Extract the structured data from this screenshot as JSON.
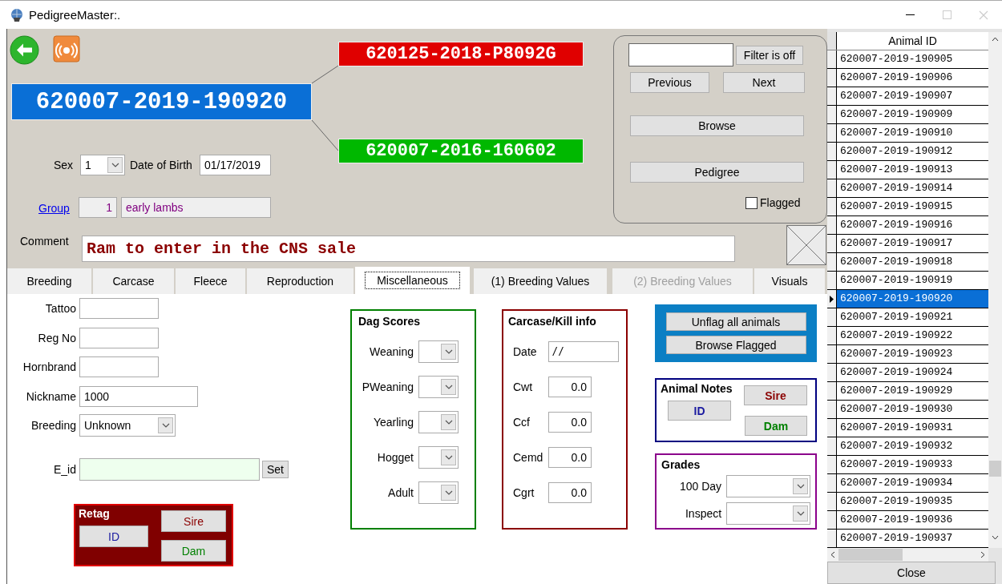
{
  "window": {
    "title": "PedigreeMaster:."
  },
  "pedigree": {
    "animal_id": "620007-2019-190920",
    "sire_id": "620125-2018-P8092G",
    "dam_id": "620007-2016-160602"
  },
  "sex": {
    "label": "Sex",
    "value": "1"
  },
  "date_of_birth": {
    "label": "Date of Birth",
    "value": "01/17/2019"
  },
  "group": {
    "label": "Group",
    "number": "1",
    "name": "early lambs"
  },
  "comment": {
    "label": "Comment",
    "value": "Ram to enter in the CNS sale"
  },
  "navigator": {
    "filter_button": "Filter is off",
    "previous": "Previous",
    "next": "Next",
    "browse": "Browse",
    "pedigree": "Pedigree",
    "flagged": {
      "label": "Flagged",
      "checked": false
    }
  },
  "tabs": [
    {
      "label": "Breeding",
      "selected": false,
      "disabled": false
    },
    {
      "label": "Carcase",
      "selected": false,
      "disabled": false
    },
    {
      "label": "Fleece",
      "selected": false,
      "disabled": false
    },
    {
      "label": "Reproduction",
      "selected": false,
      "disabled": false
    },
    {
      "label": "Miscellaneous",
      "selected": true,
      "disabled": false
    },
    {
      "label": "(1) Breeding Values",
      "selected": false,
      "disabled": false
    },
    {
      "label": "(2) Breeding Values",
      "selected": false,
      "disabled": true
    },
    {
      "label": "Visuals",
      "selected": false,
      "disabled": false
    }
  ],
  "misc_fields": [
    {
      "kind": "text",
      "label": "Tattoo"
    },
    {
      "kind": "text",
      "label": "Reg No"
    },
    {
      "kind": "text",
      "label": "Hornbrand"
    },
    {
      "kind": "wide",
      "label": "Nickname",
      "value": "1000"
    },
    {
      "kind": "dropdown",
      "label": "Breeding",
      "value": "Unknown"
    }
  ],
  "e_id": {
    "label": "E_id",
    "button": "Set"
  },
  "retag": {
    "title": "Retag",
    "id": "ID",
    "sire": "Sire",
    "dam": "Dam"
  },
  "dag_scores": {
    "title": "Dag Scores",
    "items": [
      "Weaning",
      "PWeaning",
      "Yearling",
      "Hogget",
      "Adult"
    ]
  },
  "carcase_kill": {
    "title": "Carcase/Kill info",
    "items": [
      {
        "kind": "date",
        "label": "Date",
        "value": "/ /"
      },
      {
        "kind": "number",
        "label": "Cwt",
        "value": "0.0"
      },
      {
        "kind": "number",
        "label": "Ccf",
        "value": "0.0"
      },
      {
        "kind": "number",
        "label": "Cemd",
        "value": "0.0"
      },
      {
        "kind": "number",
        "label": "Cgrt",
        "value": "0.0"
      }
    ]
  },
  "flag_actions": [
    "Unflag all animals",
    "Browse Flagged"
  ],
  "animal_notes": {
    "title": "Animal Notes",
    "id": "ID",
    "sire": "Sire",
    "dam": "Dam"
  },
  "grades": {
    "title": "Grades",
    "items": [
      "100 Day",
      "Inspect"
    ]
  },
  "animal_list": {
    "column": "Animal ID",
    "rows": [
      {
        "id": "620007-2019-190905",
        "selected": false
      },
      {
        "id": "620007-2019-190906",
        "selected": false
      },
      {
        "id": "620007-2019-190907",
        "selected": false
      },
      {
        "id": "620007-2019-190909",
        "selected": false
      },
      {
        "id": "620007-2019-190910",
        "selected": false
      },
      {
        "id": "620007-2019-190912",
        "selected": false
      },
      {
        "id": "620007-2019-190913",
        "selected": false
      },
      {
        "id": "620007-2019-190914",
        "selected": false
      },
      {
        "id": "620007-2019-190915",
        "selected": false
      },
      {
        "id": "620007-2019-190916",
        "selected": false
      },
      {
        "id": "620007-2019-190917",
        "selected": false
      },
      {
        "id": "620007-2019-190918",
        "selected": false
      },
      {
        "id": "620007-2019-190919",
        "selected": false
      },
      {
        "id": "620007-2019-190920",
        "selected": true
      },
      {
        "id": "620007-2019-190921",
        "selected": false
      },
      {
        "id": "620007-2019-190922",
        "selected": false
      },
      {
        "id": "620007-2019-190923",
        "selected": false
      },
      {
        "id": "620007-2019-190924",
        "selected": false
      },
      {
        "id": "620007-2019-190929",
        "selected": false
      },
      {
        "id": "620007-2019-190930",
        "selected": false
      },
      {
        "id": "620007-2019-190931",
        "selected": false
      },
      {
        "id": "620007-2019-190932",
        "selected": false
      },
      {
        "id": "620007-2019-190933",
        "selected": false
      },
      {
        "id": "620007-2019-190934",
        "selected": false
      },
      {
        "id": "620007-2019-190935",
        "selected": false
      },
      {
        "id": "620007-2019-190936",
        "selected": false
      },
      {
        "id": "620007-2019-190937",
        "selected": false
      }
    ],
    "close_button": "Close"
  }
}
